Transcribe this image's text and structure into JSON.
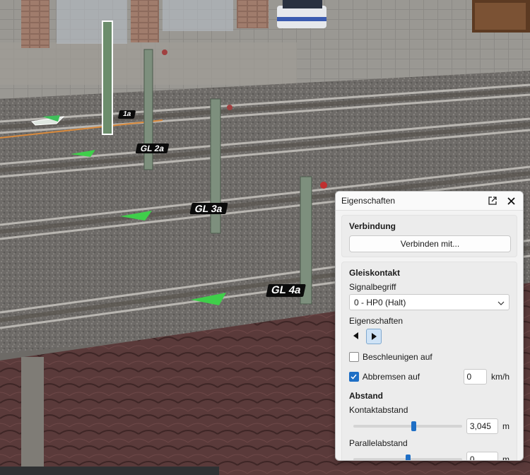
{
  "scene": {
    "track_labels": [
      "1a",
      "GL 2a",
      "GL 3a",
      "GL 4a"
    ]
  },
  "panel": {
    "title": "Eigenschaften",
    "icons": [
      "popout-icon",
      "close-icon"
    ],
    "verbindung": {
      "heading": "Verbindung",
      "button_label": "Verbinden mit..."
    },
    "gleiskontakt": {
      "heading": "Gleiskontakt",
      "signalbegriff_label": "Signalbegriff",
      "signalbegriff_value": "0 - HP0 (Halt)",
      "eigenschaften_label": "Eigenschaften",
      "beschleunigen_label": "Beschleunigen auf",
      "beschleunigen_checked": false,
      "abbremsen_label": "Abbremsen auf",
      "abbremsen_checked": true,
      "abbremsen_value": "0",
      "abbremsen_unit": "km/h"
    },
    "abstand": {
      "heading": "Abstand",
      "kontakt_label": "Kontaktabstand",
      "kontakt_value": "3,045",
      "kontakt_unit": "m",
      "kontakt_slider_fraction": 0.55,
      "parallel_label": "Parallelabstand",
      "parallel_value": "0",
      "parallel_unit": "m",
      "parallel_slider_fraction": 0.5
    },
    "accent": "#1f6fc5"
  }
}
